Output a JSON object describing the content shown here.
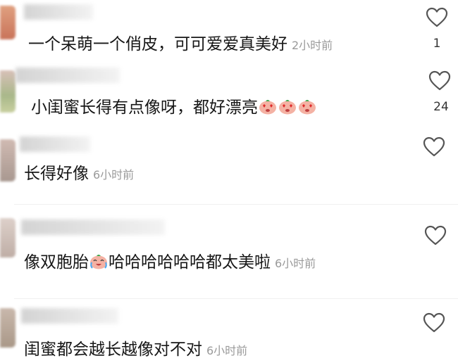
{
  "comments": [
    {
      "text": "一个呆萌一个俏皮，可可爱爱真美好",
      "time": "2小时前",
      "likes": "1",
      "emojis": []
    },
    {
      "text": "小闺蜜长得有点像呀，都好漂亮",
      "time": "",
      "likes": "24",
      "emojis": [
        "heart-eyes-emoji",
        "heart-eyes-emoji",
        "heart-eyes-emoji"
      ]
    },
    {
      "text": "长得好像",
      "time": "6小时前",
      "likes": "",
      "emojis": []
    },
    {
      "text_before": "像双胞胎",
      "text_after": "哈哈哈哈哈哈都太美啦",
      "time": "6小时前",
      "likes": "",
      "emojis": [
        "laugh-cry-emoji"
      ]
    },
    {
      "text": "闺蜜都会越长越像对不对",
      "time": "6小时前",
      "likes": "",
      "emojis": []
    }
  ],
  "colors": {
    "avatar_1": "#d98a6a",
    "avatar_2": "#c9a49a",
    "avatar_3": "#b8a8a0",
    "avatar_4": "#c8b9b2",
    "avatar_5": "#b0a090"
  }
}
